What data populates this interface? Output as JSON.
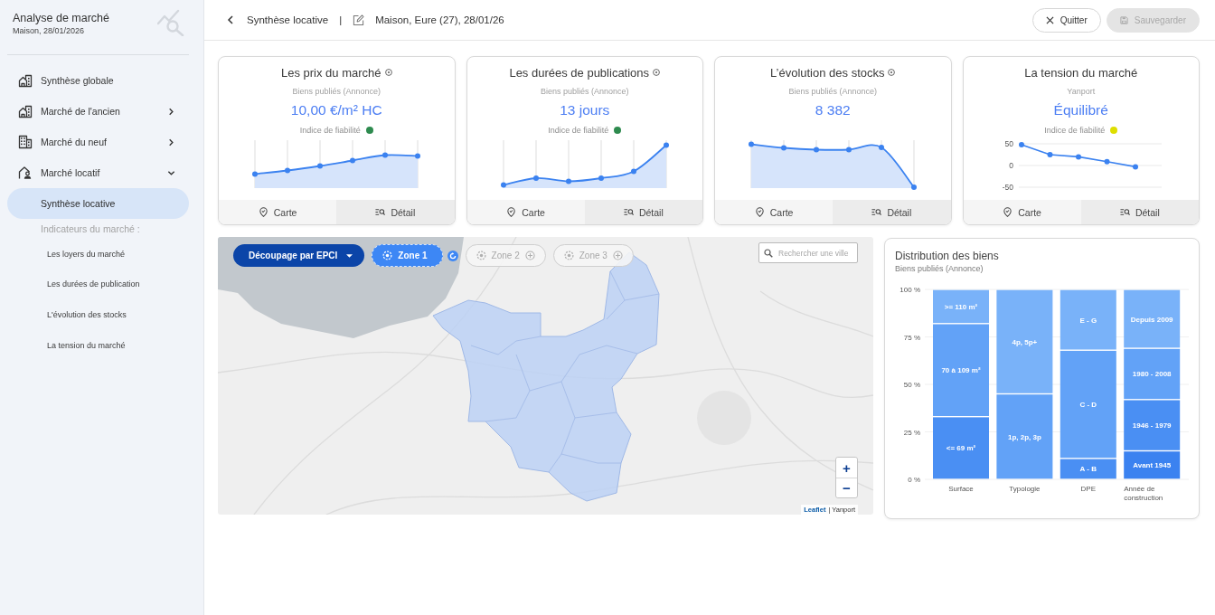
{
  "sidebar": {
    "title": "Analyse de marché",
    "subtitle": "Maison, 28/01/2026",
    "items": [
      {
        "label": "Synthèse globale",
        "kind": "link",
        "selected": false
      },
      {
        "label": "Marché de l'ancien",
        "kind": "group",
        "selected": false,
        "expanded": false
      },
      {
        "label": "Marché du neuf",
        "kind": "group",
        "selected": false,
        "expanded": false
      },
      {
        "label": "Marché locatif",
        "kind": "group",
        "selected": false,
        "expanded": true,
        "children": [
          {
            "label": "Synthèse locative",
            "kind": "link",
            "selected": true
          },
          {
            "label": "Indicateurs du marché :",
            "kind": "heading",
            "children": [
              {
                "label": "Les loyers du marché",
                "kind": "link",
                "selected": false
              },
              {
                "label": "Les durées de publication",
                "kind": "link",
                "selected": false
              },
              {
                "label": "L'évolution des stocks",
                "kind": "link",
                "selected": false
              },
              {
                "label": "La tension du marché",
                "kind": "link",
                "selected": false
              }
            ]
          }
        ]
      }
    ]
  },
  "header": {
    "title": "Synthèse locative",
    "separator": "|",
    "subject": "Maison, Eure (27), 28/01/26",
    "buttons": [
      {
        "label": "Quitter",
        "kind": "quit",
        "disabled": false
      },
      {
        "label": "Sauvegarder",
        "kind": "save",
        "disabled": true
      }
    ]
  },
  "cards": [
    {
      "title": "Les prix du marché",
      "info": true,
      "source": "Biens publiés (Annonce)",
      "value": "10,00 €/m² HC",
      "reliability": {
        "label": "Indice de fiabilité",
        "color": "#2e8b4f"
      },
      "chart": {
        "kind": "sparkline"
      },
      "actions": [
        {
          "label": "Carte",
          "kind": "map"
        },
        {
          "label": "Détail",
          "kind": "detail"
        }
      ]
    },
    {
      "title": "Les durées de publications",
      "info": true,
      "source": "Biens publiés (Annonce)",
      "value": "13 jours",
      "reliability": {
        "label": "Indice de fiabilité",
        "color": "#2e8b4f"
      },
      "chart": {
        "kind": "sparkline"
      },
      "actions": [
        {
          "label": "Carte",
          "kind": "map"
        },
        {
          "label": "Détail",
          "kind": "detail"
        }
      ]
    },
    {
      "title": "L’évolution des stocks",
      "info": true,
      "source": "Biens publiés (Annonce)",
      "value": "8 382",
      "chart": {
        "kind": "sparkline"
      },
      "actions": [
        {
          "label": "Carte",
          "kind": "map"
        },
        {
          "label": "Détail",
          "kind": "detail"
        }
      ]
    },
    {
      "title": "La tension du marché",
      "info": false,
      "source": "Yanport",
      "value": "Équilibré",
      "reliability": {
        "label": "Indice de fiabilité",
        "color": "#dede00"
      },
      "chart": {
        "kind": "line",
        "chart_data": {
          "type": "line",
          "values": [
            48,
            25,
            20,
            9,
            -3
          ],
          "ylim": [
            -50,
            50
          ],
          "yticks": [
            50,
            0,
            -50
          ],
          "marker": true
        }
      },
      "actions": [
        {
          "label": "Carte",
          "kind": "map"
        },
        {
          "label": "Détail",
          "kind": "detail"
        }
      ]
    }
  ],
  "map": {
    "division": {
      "label": "Découpage par EPCI"
    },
    "zones": [
      {
        "label": "Zone 1",
        "selected": true
      },
      {
        "label": "Zone 2",
        "selected": false
      },
      {
        "label": "Zone 3",
        "selected": false
      }
    ],
    "search": {
      "placeholder": "Rechercher une ville"
    },
    "zoom_controls": [
      "+",
      "−"
    ],
    "attribution": {
      "link": "Leaflet",
      "text": "| Yanport"
    }
  },
  "distribution": {
    "title": "Distribution des biens",
    "subtitle": "Biens publiés (Annonce)",
    "chart_data": {
      "type": "bar",
      "stacked": true,
      "categories": [
        "Surface",
        "Typologie",
        "DPE",
        "Année de construction"
      ],
      "series": [
        {
          "name": "<= 69 m²",
          "color": "#4a8ff3",
          "values": [
            33,
            null,
            null,
            null
          ]
        },
        {
          "name": "70 à 109 m²",
          "color": "#62a2f7",
          "values": [
            49,
            null,
            null,
            null
          ]
        },
        {
          "name": ">= 110 m²",
          "color": "#79b2f9",
          "values": [
            18,
            null,
            null,
            null
          ]
        },
        {
          "name": "1p, 2p, 3p",
          "color": "#62a2f7",
          "values": [
            null,
            45,
            null,
            null
          ]
        },
        {
          "name": "4p, 5p+",
          "color": "#79b2f9",
          "values": [
            null,
            55,
            null,
            null
          ]
        },
        {
          "name": "A - B",
          "color": "#4a8ff3",
          "values": [
            null,
            null,
            11,
            null
          ]
        },
        {
          "name": "C - D",
          "color": "#62a2f7",
          "values": [
            null,
            null,
            57,
            null
          ]
        },
        {
          "name": "E - G",
          "color": "#79b2f9",
          "values": [
            null,
            null,
            32,
            null
          ]
        },
        {
          "name": "Avant 1945",
          "color": "#3b82f0",
          "values": [
            null,
            null,
            null,
            15
          ]
        },
        {
          "name": "1946 - 1979",
          "color": "#4a8ff3",
          "values": [
            null,
            null,
            null,
            27
          ]
        },
        {
          "name": "1980 - 2008",
          "color": "#62a2f7",
          "values": [
            null,
            null,
            null,
            27
          ]
        },
        {
          "name": "Depuis 2009",
          "color": "#79b2f9",
          "values": [
            null,
            null,
            null,
            31
          ]
        }
      ],
      "ylim": [
        0,
        100
      ],
      "yticks": [
        {
          "value": 0,
          "label": "0 %"
        },
        {
          "value": 25,
          "label": "25 %"
        },
        {
          "value": 50,
          "label": "50 %"
        },
        {
          "value": 75,
          "label": "75 %"
        },
        {
          "value": 100,
          "label": "100 %"
        }
      ],
      "grid": true
    }
  }
}
